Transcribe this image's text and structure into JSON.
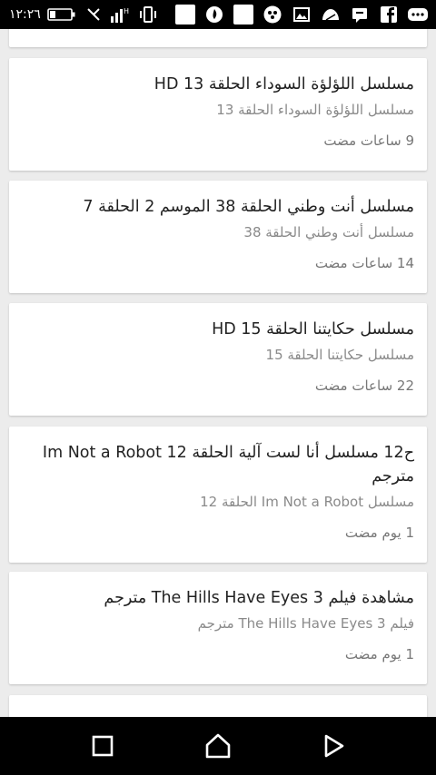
{
  "status_bar": {
    "time": "١٢:٢٦"
  },
  "cards": [
    {
      "title": "",
      "subtitle": "",
      "time": ""
    },
    {
      "title": "مسلسل اللؤلؤة السوداء الحلقة 13 HD",
      "subtitle": "مسلسل اللؤلؤة السوداء الحلقة 13",
      "time": "9 ساعات مضت"
    },
    {
      "title": "مسلسل أنت وطني الحلقة 38 الموسم 2 الحلقة 7",
      "subtitle": "مسلسل أنت وطني الحلقة 38",
      "time": "14 ساعات مضت"
    },
    {
      "title": "مسلسل حكايتنا الحلقة 15 HD",
      "subtitle": "مسلسل حكايتنا الحلقة 15",
      "time": "22 ساعات مضت"
    },
    {
      "title": "ح12 مسلسل أنا لست آلية الحلقة 12 Im Not a Robot مترجم",
      "subtitle": "مسلسل Im Not a Robot الحلقة 12",
      "time": "1 يوم مضت"
    },
    {
      "title": "مشاهدة فيلم The Hills Have Eyes 3 مترجم",
      "subtitle": "فيلم The Hills Have Eyes 3 مترجم",
      "time": "1 يوم مضت"
    },
    {
      "title": "",
      "subtitle": "",
      "time": ""
    }
  ],
  "icons": {
    "status": [
      "battery-icon",
      "signal-icon",
      "vibrate-icon",
      "notification-icon",
      "flame-icon",
      "dots-icon",
      "image-icon",
      "cloud-icon",
      "message-icon",
      "facebook-icon",
      "chat-icon"
    ],
    "nav": [
      "recents-icon",
      "home-icon",
      "back-icon"
    ]
  }
}
